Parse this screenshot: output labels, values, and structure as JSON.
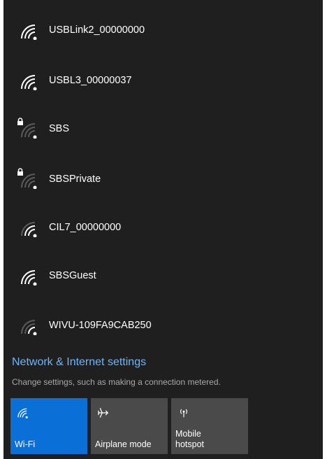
{
  "networks": [
    {
      "ssid": "USBLink2_00000000",
      "secured": false,
      "signal": "full"
    },
    {
      "ssid": "USBL3_00000037",
      "secured": false,
      "signal": "full"
    },
    {
      "ssid": "SBS",
      "secured": true,
      "signal": "weak"
    },
    {
      "ssid": "SBSPrivate",
      "secured": true,
      "signal": "weak"
    },
    {
      "ssid": "CIL7_00000000",
      "secured": false,
      "signal": "medium"
    },
    {
      "ssid": "SBSGuest",
      "secured": false,
      "signal": "full"
    },
    {
      "ssid": "WIVU-109FA9CAB250",
      "secured": false,
      "signal": "weak"
    }
  ],
  "settings": {
    "link": "Network & Internet settings",
    "description": "Change settings, such as making a connection metered."
  },
  "quick_actions": {
    "wifi": {
      "label": "Wi-Fi",
      "icon": "wifi-icon",
      "active": true
    },
    "airplane": {
      "label": "Airplane mode",
      "icon": "airplane-icon",
      "active": false
    },
    "hotspot": {
      "label_line1": "Mobile",
      "label_line2": "hotspot",
      "icon": "hotspot-icon",
      "active": false
    }
  },
  "colors": {
    "background": "#1f1f1f",
    "accent": "#0a6fd6",
    "link": "#6ab7ff",
    "tile": "#4a4a4a"
  }
}
